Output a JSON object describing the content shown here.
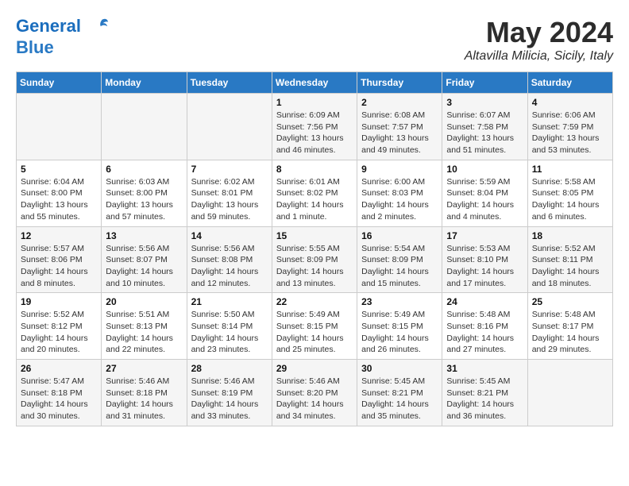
{
  "header": {
    "logo_line1": "General",
    "logo_line2": "Blue",
    "month": "May 2024",
    "location": "Altavilla Milicia, Sicily, Italy"
  },
  "weekdays": [
    "Sunday",
    "Monday",
    "Tuesday",
    "Wednesday",
    "Thursday",
    "Friday",
    "Saturday"
  ],
  "weeks": [
    [
      {
        "day": "",
        "info": ""
      },
      {
        "day": "",
        "info": ""
      },
      {
        "day": "",
        "info": ""
      },
      {
        "day": "1",
        "info": "Sunrise: 6:09 AM\nSunset: 7:56 PM\nDaylight: 13 hours\nand 46 minutes."
      },
      {
        "day": "2",
        "info": "Sunrise: 6:08 AM\nSunset: 7:57 PM\nDaylight: 13 hours\nand 49 minutes."
      },
      {
        "day": "3",
        "info": "Sunrise: 6:07 AM\nSunset: 7:58 PM\nDaylight: 13 hours\nand 51 minutes."
      },
      {
        "day": "4",
        "info": "Sunrise: 6:06 AM\nSunset: 7:59 PM\nDaylight: 13 hours\nand 53 minutes."
      }
    ],
    [
      {
        "day": "5",
        "info": "Sunrise: 6:04 AM\nSunset: 8:00 PM\nDaylight: 13 hours\nand 55 minutes."
      },
      {
        "day": "6",
        "info": "Sunrise: 6:03 AM\nSunset: 8:00 PM\nDaylight: 13 hours\nand 57 minutes."
      },
      {
        "day": "7",
        "info": "Sunrise: 6:02 AM\nSunset: 8:01 PM\nDaylight: 13 hours\nand 59 minutes."
      },
      {
        "day": "8",
        "info": "Sunrise: 6:01 AM\nSunset: 8:02 PM\nDaylight: 14 hours\nand 1 minute."
      },
      {
        "day": "9",
        "info": "Sunrise: 6:00 AM\nSunset: 8:03 PM\nDaylight: 14 hours\nand 2 minutes."
      },
      {
        "day": "10",
        "info": "Sunrise: 5:59 AM\nSunset: 8:04 PM\nDaylight: 14 hours\nand 4 minutes."
      },
      {
        "day": "11",
        "info": "Sunrise: 5:58 AM\nSunset: 8:05 PM\nDaylight: 14 hours\nand 6 minutes."
      }
    ],
    [
      {
        "day": "12",
        "info": "Sunrise: 5:57 AM\nSunset: 8:06 PM\nDaylight: 14 hours\nand 8 minutes."
      },
      {
        "day": "13",
        "info": "Sunrise: 5:56 AM\nSunset: 8:07 PM\nDaylight: 14 hours\nand 10 minutes."
      },
      {
        "day": "14",
        "info": "Sunrise: 5:56 AM\nSunset: 8:08 PM\nDaylight: 14 hours\nand 12 minutes."
      },
      {
        "day": "15",
        "info": "Sunrise: 5:55 AM\nSunset: 8:09 PM\nDaylight: 14 hours\nand 13 minutes."
      },
      {
        "day": "16",
        "info": "Sunrise: 5:54 AM\nSunset: 8:09 PM\nDaylight: 14 hours\nand 15 minutes."
      },
      {
        "day": "17",
        "info": "Sunrise: 5:53 AM\nSunset: 8:10 PM\nDaylight: 14 hours\nand 17 minutes."
      },
      {
        "day": "18",
        "info": "Sunrise: 5:52 AM\nSunset: 8:11 PM\nDaylight: 14 hours\nand 18 minutes."
      }
    ],
    [
      {
        "day": "19",
        "info": "Sunrise: 5:52 AM\nSunset: 8:12 PM\nDaylight: 14 hours\nand 20 minutes."
      },
      {
        "day": "20",
        "info": "Sunrise: 5:51 AM\nSunset: 8:13 PM\nDaylight: 14 hours\nand 22 minutes."
      },
      {
        "day": "21",
        "info": "Sunrise: 5:50 AM\nSunset: 8:14 PM\nDaylight: 14 hours\nand 23 minutes."
      },
      {
        "day": "22",
        "info": "Sunrise: 5:49 AM\nSunset: 8:15 PM\nDaylight: 14 hours\nand 25 minutes."
      },
      {
        "day": "23",
        "info": "Sunrise: 5:49 AM\nSunset: 8:15 PM\nDaylight: 14 hours\nand 26 minutes."
      },
      {
        "day": "24",
        "info": "Sunrise: 5:48 AM\nSunset: 8:16 PM\nDaylight: 14 hours\nand 27 minutes."
      },
      {
        "day": "25",
        "info": "Sunrise: 5:48 AM\nSunset: 8:17 PM\nDaylight: 14 hours\nand 29 minutes."
      }
    ],
    [
      {
        "day": "26",
        "info": "Sunrise: 5:47 AM\nSunset: 8:18 PM\nDaylight: 14 hours\nand 30 minutes."
      },
      {
        "day": "27",
        "info": "Sunrise: 5:46 AM\nSunset: 8:18 PM\nDaylight: 14 hours\nand 31 minutes."
      },
      {
        "day": "28",
        "info": "Sunrise: 5:46 AM\nSunset: 8:19 PM\nDaylight: 14 hours\nand 33 minutes."
      },
      {
        "day": "29",
        "info": "Sunrise: 5:46 AM\nSunset: 8:20 PM\nDaylight: 14 hours\nand 34 minutes."
      },
      {
        "day": "30",
        "info": "Sunrise: 5:45 AM\nSunset: 8:21 PM\nDaylight: 14 hours\nand 35 minutes."
      },
      {
        "day": "31",
        "info": "Sunrise: 5:45 AM\nSunset: 8:21 PM\nDaylight: 14 hours\nand 36 minutes."
      },
      {
        "day": "",
        "info": ""
      }
    ]
  ]
}
